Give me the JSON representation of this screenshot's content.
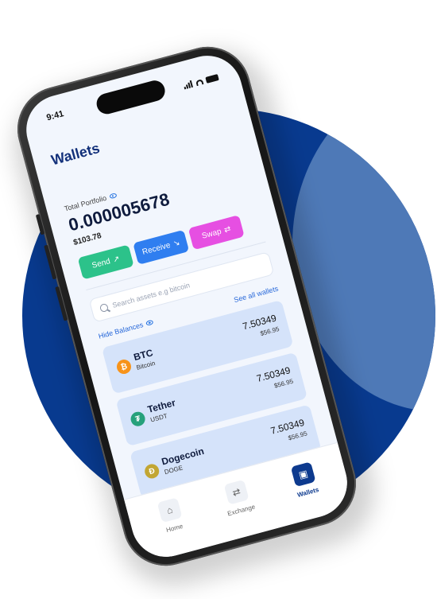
{
  "status": {
    "time": "9:41"
  },
  "title": "Wallets",
  "portfolio": {
    "label": "Total Portfolio",
    "balance": "0.000005678",
    "fiat": "$103.78"
  },
  "actions": [
    {
      "label": "Send",
      "icon": "↗",
      "color": "#2cc28a"
    },
    {
      "label": "Receive",
      "icon": "↘",
      "color": "#2f7ef0"
    },
    {
      "label": "Swap",
      "icon": "⇄",
      "color": "#e64fe2"
    }
  ],
  "search": {
    "placeholder": "Search assets e.g bitcoin"
  },
  "links": {
    "hide_balances": "Hide Balances",
    "see_all": "See all wallets"
  },
  "assets": [
    {
      "symbol": "BTC",
      "name": "Bitcoin",
      "amount": "7.50349",
      "fiat": "$56.95",
      "glyph": "₿",
      "color": "#f7931a"
    },
    {
      "symbol": "Tether",
      "name": "USDT",
      "amount": "7.50349",
      "fiat": "$56.95",
      "glyph": "₮",
      "color": "#26a17b"
    },
    {
      "symbol": "Dogecoin",
      "name": "DOGE",
      "amount": "7.50349",
      "fiat": "$56.95",
      "glyph": "Ð",
      "color": "#c2a633"
    }
  ],
  "tabs": [
    {
      "label": "Home",
      "icon": "home-icon",
      "glyph": "⌂"
    },
    {
      "label": "Exchange",
      "icon": "exchange-icon",
      "glyph": "⇄"
    },
    {
      "label": "Wallets",
      "icon": "wallet-icon",
      "glyph": "▣",
      "active": true
    }
  ]
}
